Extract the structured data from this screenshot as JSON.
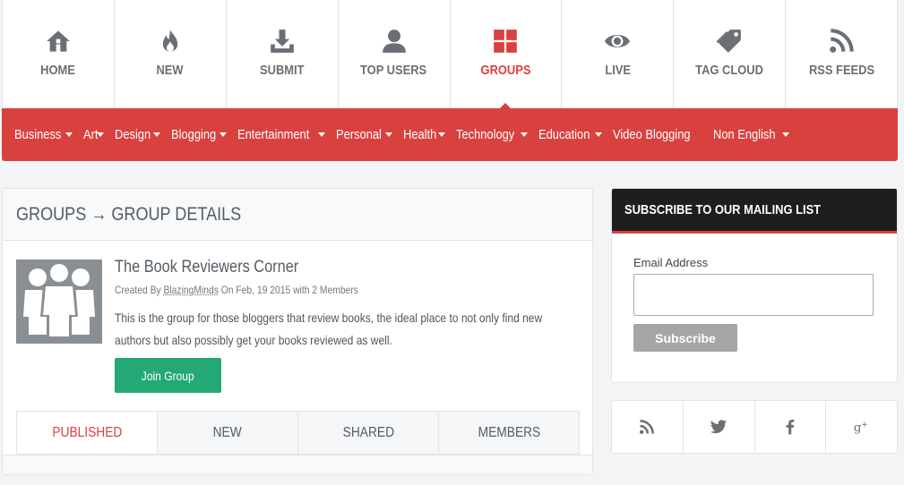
{
  "topnav": [
    {
      "label": "HOME",
      "icon": "home-icon"
    },
    {
      "label": "NEW",
      "icon": "fire-icon"
    },
    {
      "label": "SUBMIT",
      "icon": "download-icon"
    },
    {
      "label": "TOP USERS",
      "icon": "user-icon"
    },
    {
      "label": "GROUPS",
      "icon": "grid-icon",
      "active": true
    },
    {
      "label": "LIVE",
      "icon": "eye-icon"
    },
    {
      "label": "TAG CLOUD",
      "icon": "tags-icon"
    },
    {
      "label": "RSS FEEDS",
      "icon": "rss-icon"
    }
  ],
  "categories": [
    {
      "label": "Business",
      "dropdown": true
    },
    {
      "label": "Art",
      "dropdown": true
    },
    {
      "label": "Design",
      "dropdown": true
    },
    {
      "label": "Blogging",
      "dropdown": true
    },
    {
      "label": "Entertainment",
      "dropdown": true
    },
    {
      "label": "Personal",
      "dropdown": true
    },
    {
      "label": "Health",
      "dropdown": true
    },
    {
      "label": "Technology",
      "dropdown": true
    },
    {
      "label": "Education",
      "dropdown": true
    },
    {
      "label": "Video Blogging",
      "dropdown": false
    },
    {
      "label": "Non English",
      "dropdown": true
    }
  ],
  "main": {
    "heading": "GROUPS → GROUP DETAILS",
    "group": {
      "title": "The Book Reviewers Corner",
      "meta_prefix": "Created By ",
      "author": "BlazingMinds",
      "meta_suffix": " On Feb, 19 2015 with 2 Members",
      "description": "This is the group for those bloggers that review books, the ideal place to not only find new authors but also possibly get your books reviewed as well.",
      "join_label": "Join Group"
    },
    "tabs": [
      {
        "label": "PUBLISHED",
        "active": true
      },
      {
        "label": "NEW"
      },
      {
        "label": "SHARED"
      },
      {
        "label": "MEMBERS"
      }
    ]
  },
  "subscribe": {
    "heading": "SUBSCRIBE TO OUR MAILING LIST",
    "email_label": "Email Address",
    "email_value": "",
    "button_label": "Subscribe"
  },
  "social": [
    "rss-icon",
    "twitter-icon",
    "facebook-icon",
    "google-plus-icon"
  ],
  "colors": {
    "accent": "#d9413f",
    "join": "#24a876",
    "dark": "#1c1e20",
    "icon": "#6a6f75"
  }
}
